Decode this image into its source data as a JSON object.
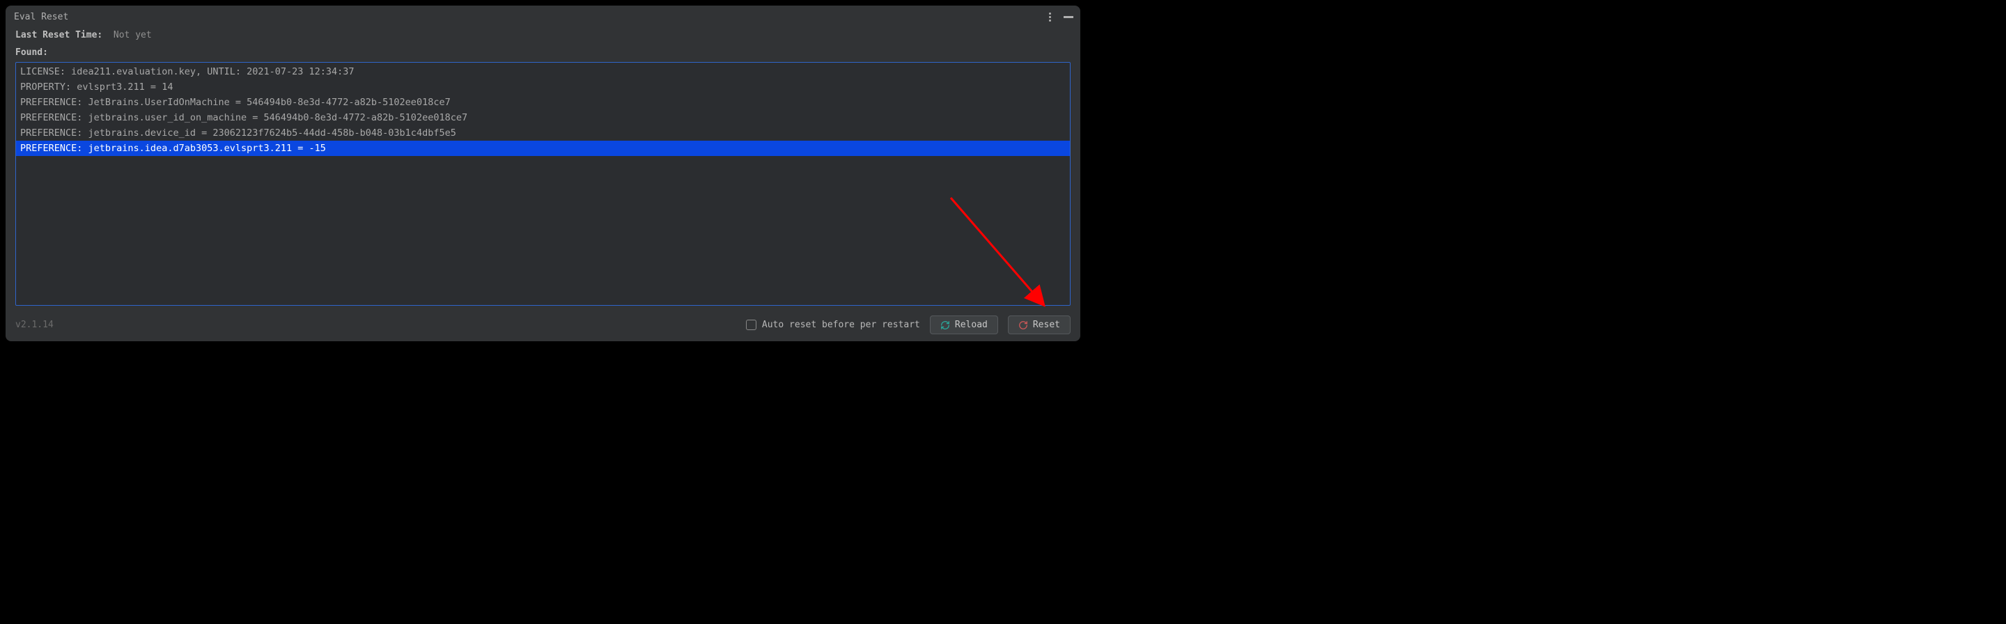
{
  "titleBar": {
    "title": "Eval Reset"
  },
  "info": {
    "lastResetLabel": "Last Reset Time:",
    "lastResetValue": "Not yet"
  },
  "foundLabel": "Found:",
  "log": {
    "lines": [
      {
        "text": "LICENSE: idea211.evaluation.key, UNTIL: 2021-07-23 12:34:37",
        "selected": false
      },
      {
        "text": "PROPERTY: evlsprt3.211 = 14",
        "selected": false
      },
      {
        "text": "PREFERENCE: JetBrains.UserIdOnMachine = 546494b0-8e3d-4772-a82b-5102ee018ce7",
        "selected": false
      },
      {
        "text": "PREFERENCE: jetbrains.user_id_on_machine = 546494b0-8e3d-4772-a82b-5102ee018ce7",
        "selected": false
      },
      {
        "text": "PREFERENCE: jetbrains.device_id = 23062123f7624b5-44dd-458b-b048-03b1c4dbf5e5",
        "selected": false
      },
      {
        "text": "PREFERENCE: jetbrains.idea.d7ab3053.evlsprt3.211 = -15",
        "selected": true
      }
    ]
  },
  "footer": {
    "version": "v2.1.14",
    "autoResetLabel": "Auto reset before per restart",
    "reloadLabel": "Reload",
    "resetLabel": "Reset"
  }
}
